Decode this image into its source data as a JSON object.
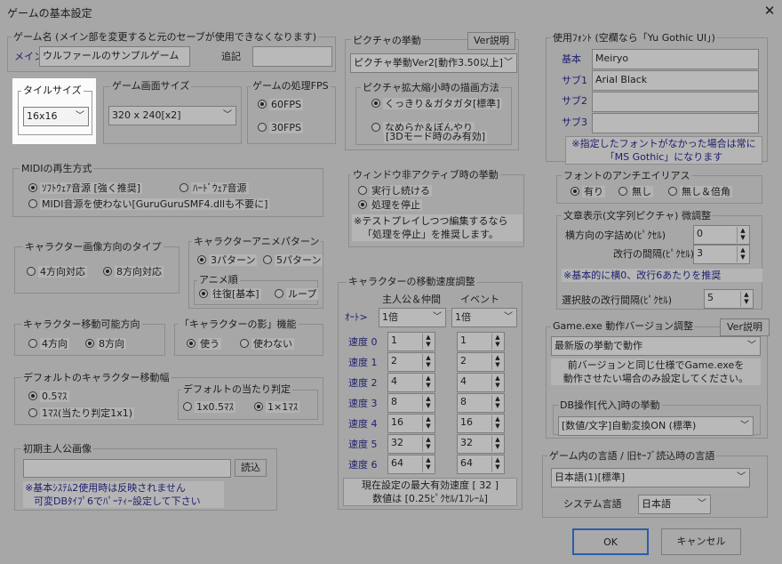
{
  "window": {
    "title": "ゲームの基本設定"
  },
  "game_name": {
    "title": "ゲーム名 (メイン部を変更すると元のセーブが使用できなくなります)",
    "main_label": "メイン",
    "main_value": "ウルファールのサンプルゲーム",
    "append_label": "追記",
    "append_value": ""
  },
  "tile_size": {
    "title": "タイルサイズ",
    "value": "16x16"
  },
  "screen_size": {
    "title": "ゲーム画面サイズ",
    "value": "320 x 240[x2]"
  },
  "fps": {
    "title": "ゲームの処理FPS",
    "opt1": "60FPS",
    "opt2": "30FPS"
  },
  "picture": {
    "title": "ピクチャの挙動",
    "help": "Ver説明",
    "value": "ピクチャ挙動Ver2[動作3.50以上]",
    "scale_title": "ピクチャ拡大縮小時の描画方法",
    "scale_opt1": "くっきり＆ガタガタ[標準]",
    "scale_opt2_l1": "なめらか＆ぼんやり",
    "scale_opt2_l2": "[3Dモード時のみ有効]"
  },
  "midi": {
    "title": "MIDIの再生方式",
    "opt1": "ｿﾌﾄｳｪｱ音源 [強く推奨]",
    "opt2": "ﾊｰﾄﾞｳｪｱ音源",
    "opt3": "MIDI音源を使わない[GuruGuruSMF4.dllも不要に]"
  },
  "inactive": {
    "title": "ウィンドウ非アクティブ時の挙動",
    "opt1": "実行し続ける",
    "opt2": "処理を停止",
    "note_l1": "※テストプレイしつつ編集するなら",
    "note_l2": "「処理を停止」を推奨します。"
  },
  "char_dir": {
    "title": "キャラクター画像方向のタイプ",
    "opt1": "4方向対応",
    "opt2": "8方向対応"
  },
  "char_anim": {
    "title": "キャラクターアニメパターン",
    "opt1": "3パターン",
    "opt2": "5パターン",
    "order_title": "アニメ順",
    "order_opt1": "往復[基本]",
    "order_opt2": "ループ"
  },
  "char_move_dir": {
    "title": "キャラクター移動可能方向",
    "opt1": "4方向",
    "opt2": "8方向"
  },
  "shadow": {
    "title": "「キャラクターの影」機能",
    "opt1": "使う",
    "opt2": "使わない"
  },
  "move_width": {
    "title": "デフォルトのキャラクター移動幅",
    "opt1": "0.5ﾏｽ",
    "opt2": "1ﾏｽ(当たり判定1x1)"
  },
  "hit": {
    "title": "デフォルトの当たり判定",
    "opt1": "1x0.5ﾏｽ",
    "opt2": "1×1ﾏｽ"
  },
  "initial_hero": {
    "title": "初期主人公画像",
    "value": "",
    "load": "読込",
    "note_l1": "※基本ｼｽﾃﾑ2使用時は反映されません",
    "note_l2": "可変DBﾀｲﾌﾟ6でﾊﾟｰﾃｨｰ設定して下さい"
  },
  "speed": {
    "title": "キャラクターの移動速度調整",
    "col1": "主人公＆仲間",
    "col2": "イベント",
    "auto_label": "ｵｰﾄ>",
    "auto1": "1倍",
    "auto2": "1倍",
    "rows": [
      {
        "label": "速度 0",
        "v1": "1",
        "v2": "1"
      },
      {
        "label": "速度 1",
        "v1": "2",
        "v2": "2"
      },
      {
        "label": "速度 2",
        "v1": "4",
        "v2": "4"
      },
      {
        "label": "速度 3",
        "v1": "8",
        "v2": "8"
      },
      {
        "label": "速度 4",
        "v1": "16",
        "v2": "16"
      },
      {
        "label": "速度 5",
        "v1": "32",
        "v2": "32"
      },
      {
        "label": "速度 6",
        "v1": "64",
        "v2": "64"
      }
    ],
    "note_l1": "現在設定の最大有効速度 [ 32 ]",
    "note_l2": "数値は [0.25ﾋﾟｸｾﾙ/1ﾌﾚｰﾑ]"
  },
  "fonts": {
    "title": "使用ﾌｫﾝﾄ (空欄なら「Yu Gothic UI」)",
    "basic_label": "基本",
    "basic_value": "Meiryo",
    "sub1_label": "サブ1",
    "sub1_value": "Arial Black",
    "sub2_label": "サブ2",
    "sub2_value": "",
    "sub3_label": "サブ3",
    "sub3_value": "",
    "note_l1": "※指定したフォントがなかった場合は常に",
    "note_l2": "「MS Gothic」になります"
  },
  "antialias": {
    "title": "フォントのアンチエイリアス",
    "opt1": "有り",
    "opt2": "無し",
    "opt3": "無し＆倍角"
  },
  "text_display": {
    "title": "文章表示(文字列ピクチャ) 微調整",
    "hspace_label": "横方向の字詰め(ﾋﾟｸｾﾙ)",
    "hspace_value": "0",
    "linegap_label": "改行の間隔(ﾋﾟｸｾﾙ)",
    "linegap_value": "3",
    "note": "※基本的に横0、改行6あたりを推奨",
    "choice_label": "選択肢の改行間隔(ﾋﾟｸｾﾙ)",
    "choice_value": "5"
  },
  "version": {
    "title": "Game.exe 動作バージョン調整",
    "help": "Ver説明",
    "value": "最新版の挙動で動作",
    "note_l1": "前バージョンと同じ仕様でGame.exeを",
    "note_l2": "動作させたい場合のみ設定してください。",
    "db_title": "DB操作[代入]時の挙動",
    "db_value": "[数値/文字]自動変換ON (標準)"
  },
  "language": {
    "title": "ゲーム内の言語 / 旧ｾｰﾌﾞ読込時の言語",
    "value": "日本語(1)[標準]",
    "sys_label": "システム言語",
    "sys_value": "日本語"
  },
  "buttons": {
    "ok": "OK",
    "cancel": "キャンセル"
  }
}
